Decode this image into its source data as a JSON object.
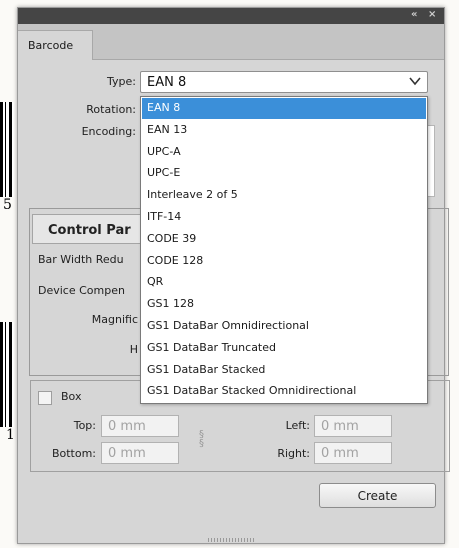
{
  "background": {
    "digit_top": "5",
    "digit_bottom": "1"
  },
  "window": {
    "collapse_glyph": "«",
    "close_glyph": "×"
  },
  "tab": {
    "label": "Barcode"
  },
  "type": {
    "label": "Type:",
    "value": "EAN 8",
    "options": [
      "EAN 8",
      "EAN 13",
      "UPC-A",
      "UPC-E",
      "Interleave 2 of 5",
      "ITF-14",
      "CODE 39",
      "CODE 128",
      "QR",
      "GS1 128",
      "GS1 DataBar Omnidirectional",
      "GS1 DataBar Truncated",
      "GS1 DataBar Stacked",
      "GS1 DataBar Stacked Omnidirectional"
    ],
    "selected_index": 0
  },
  "rotation": {
    "label": "Rotation:"
  },
  "encoding": {
    "label": "Encoding:"
  },
  "control_panel": {
    "title": "Control Par",
    "bar_width_label": "Bar Width Redu",
    "device_comp_label": "Device Compen",
    "magnification_label": "Magnific",
    "height_label": "H"
  },
  "box": {
    "label": "Box",
    "top_label": "Top:",
    "top_value": "0 mm",
    "bottom_label": "Bottom:",
    "bottom_value": "0 mm",
    "left_label": "Left:",
    "left_value": "0 mm",
    "right_label": "Right:",
    "right_value": "0 mm"
  },
  "create_button": "Create",
  "colors": {
    "selection": "#3b8fd9",
    "panel": "#d6d6d6",
    "titlebar": "#454545"
  },
  "icons": {
    "dropdown": "chevron-down-icon",
    "link": "link-chain-icon"
  }
}
